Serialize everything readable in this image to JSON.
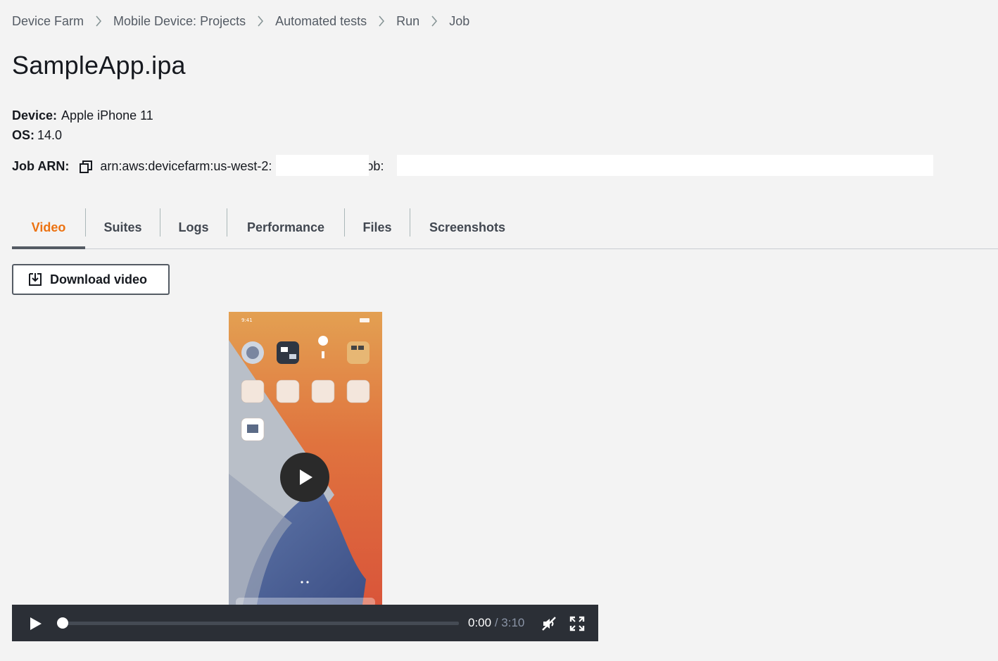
{
  "breadcrumb": [
    {
      "label": "Device Farm"
    },
    {
      "label": "Mobile Device: Projects"
    },
    {
      "label": "Automated tests"
    },
    {
      "label": "Run"
    },
    {
      "label": "Job"
    }
  ],
  "page_title": "SampleApp.ipa",
  "meta": {
    "device_label": "Device:",
    "device_value": "Apple iPhone 11",
    "os_label": "OS:",
    "os_value": "14.0",
    "arn_label": "Job ARN:",
    "arn_prefix": "arn:aws:devicefarm:us-west-2:",
    "arn_job": "job:"
  },
  "tabs": [
    {
      "label": "Video",
      "active": true
    },
    {
      "label": "Suites"
    },
    {
      "label": "Logs"
    },
    {
      "label": "Performance"
    },
    {
      "label": "Files"
    },
    {
      "label": "Screenshots"
    }
  ],
  "download_button": "Download video",
  "player": {
    "current_time": "0:00",
    "separator": " / ",
    "duration": "3:10",
    "progress": 0
  },
  "colors": {
    "accent": "#ec7211",
    "text": "#16191f",
    "secondary": "#545b64",
    "player_bar": "#2b2f36"
  }
}
